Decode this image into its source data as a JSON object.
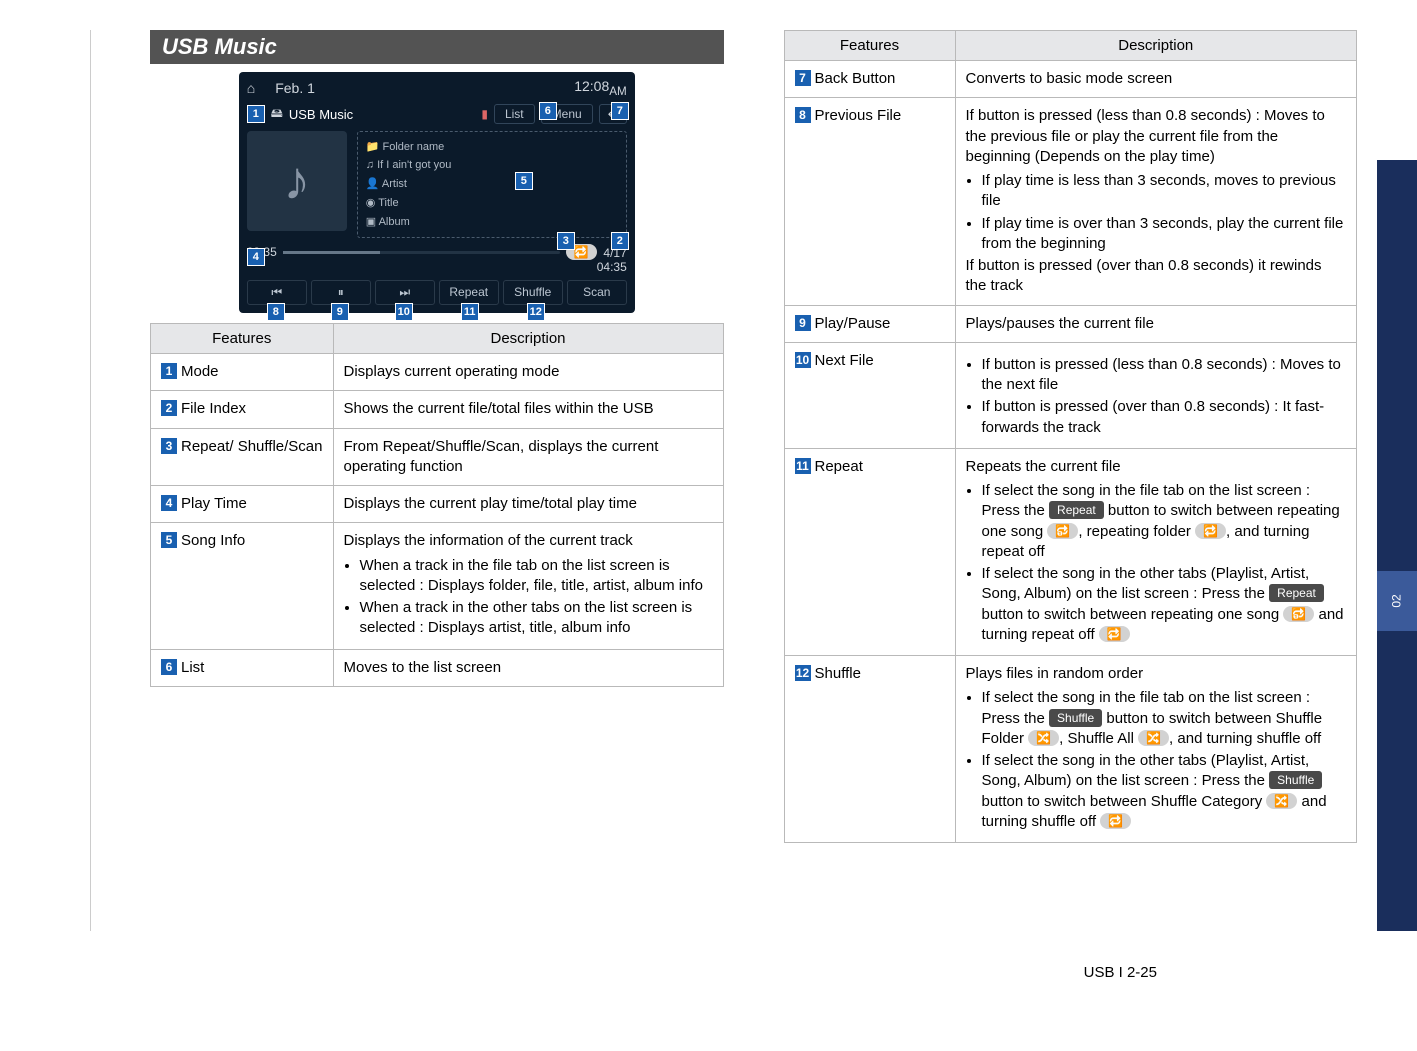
{
  "page": {
    "section_heading": "USB Music",
    "footer": "USB I 2-25",
    "side_chapter": "02"
  },
  "screenshot": {
    "date": "Feb.  1",
    "time": "12:08",
    "ampm": "AM",
    "mode_title": "USB Music",
    "list_btn": "List",
    "menu_btn": "Menu",
    "meta": {
      "folder": "Folder name",
      "track": "If I ain't got you",
      "artist": "Artist",
      "title": "Title",
      "album": "Album"
    },
    "elapsed": "03:35",
    "total": "04:35",
    "index": "4/17",
    "controls": {
      "prev": "⏮",
      "play": "⏸",
      "next": "⏭",
      "repeat": "Repeat",
      "shuffle": "Shuffle",
      "scan": "Scan"
    }
  },
  "table1": {
    "th_feat": "Features",
    "th_desc": "Description",
    "r1": {
      "n": "1",
      "f": "Mode",
      "d": "Displays current operating mode"
    },
    "r2": {
      "n": "2",
      "f": "File Index",
      "d": "Shows the current file/total files within the USB"
    },
    "r3": {
      "n": "3",
      "f": "Repeat/ Shuffle/Scan",
      "d": "From Repeat/Shuffle/Scan, displays the current operating function"
    },
    "r4": {
      "n": "4",
      "f": "Play Time",
      "d": "Displays the current play time/total play time"
    },
    "r5": {
      "n": "5",
      "f": "Song Info",
      "d_lead": "Displays the information of the current track",
      "d_b1": "When a track in the file tab on the list screen is selected : Displays folder, file, title, artist, album info",
      "d_b2": "When a track in the other tabs on the list screen is selected : Displays artist, title, album info"
    },
    "r6": {
      "n": "6",
      "f": "List",
      "d": "Moves to the list screen"
    }
  },
  "table2": {
    "th_feat": "Features",
    "th_desc": "Description",
    "r7": {
      "n": "7",
      "f": "Back Button",
      "d": "Converts to basic mode screen"
    },
    "r8": {
      "n": "8",
      "f": "Previous File",
      "d_lead": "If button is pressed (less than 0.8 seconds) : Moves to the previous file or play the current file from the beginning (Depends on the play time)",
      "d_b1": "If play time is less than 3 seconds, moves to previous file",
      "d_b2": "If play time is over than 3 seconds, play the current file from the beginning",
      "d_tail": "If button is pressed (over than 0.8 seconds) it rewinds the track"
    },
    "r9": {
      "n": "9",
      "f": "Play/Pause",
      "d": "Plays/pauses the current file"
    },
    "r10": {
      "n": "10",
      "f": "Next File",
      "d_b1": "If button is pressed (less than 0.8 seconds) : Moves to the next file",
      "d_b2": "If button is pressed (over than 0.8 seconds) : It fast-forwards the track"
    },
    "r11": {
      "n": "11",
      "f": "Repeat",
      "d_lead": "Repeats the current file",
      "d_b1a": "If select the song in the file tab on the list screen : Press the ",
      "d_b1_chip": "Repeat",
      "d_b1b": " button to switch between repeating one song ",
      "d_b1c": ", repeating folder ",
      "d_b1d": ", and turning repeat off",
      "d_b2a": "If select the song in the other tabs (Playlist, Artist, Song, Album) on the list screen : Press the ",
      "d_b2_chip": "Repeat",
      "d_b2b": " button to switch between repeating one song ",
      "d_b2c": " and turning repeat off "
    },
    "r12": {
      "n": "12",
      "f": "Shuffle",
      "d_lead": "Plays files in random order",
      "d_b1a": "If select the song in the file tab on the list screen : Press the ",
      "d_b1_chip": "Shuffle",
      "d_b1b": " button to switch between Shuffle Folder ",
      "d_b1c": ", Shuffle All ",
      "d_b1d": ", and turning shuffle off",
      "d_b2a": "If select the song in the other tabs (Playlist, Artist, Song, Album) on the list screen : Press the ",
      "d_b2_chip": "Shuffle",
      "d_b2b": " button to switch between Shuffle Category ",
      "d_b2c": " and turning shuffle off "
    },
    "icons": {
      "repeat_one": "🔂",
      "repeat_folder": "🔁",
      "repeat_off": "🔁",
      "shuffle": "🔀"
    }
  }
}
